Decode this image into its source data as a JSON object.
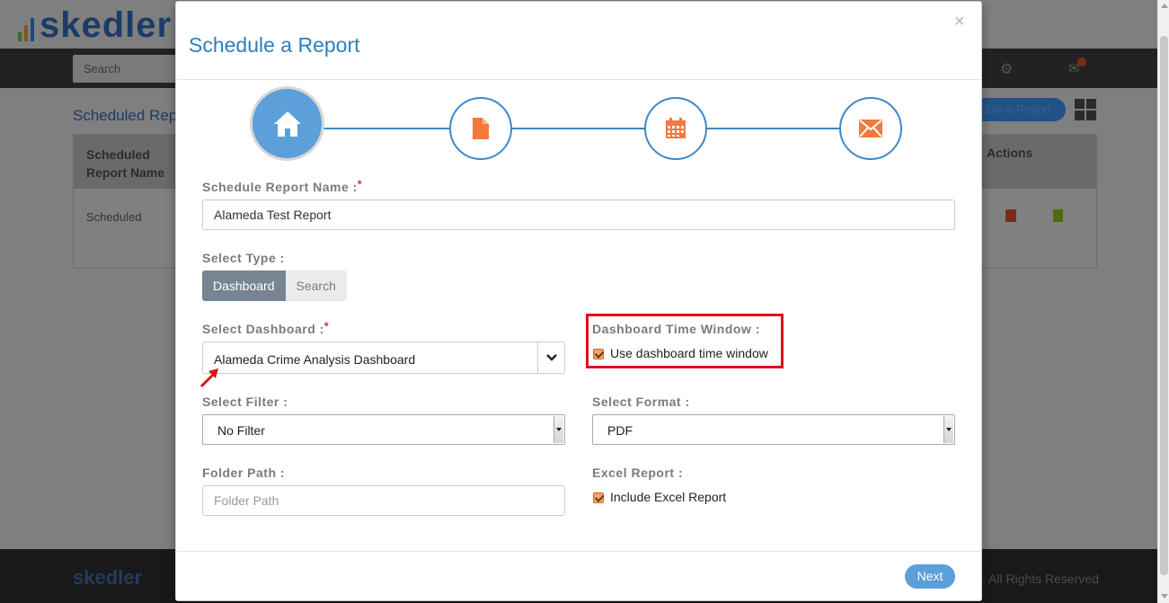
{
  "background": {
    "logo_text": "skedler",
    "search_placeholder": "Search",
    "page_heading": "Scheduled Repo",
    "new_button_label": "dule a Report",
    "table": {
      "col_name_header": "Scheduled Report Name",
      "col_actions_header": "Actions",
      "row_name": "Scheduled"
    },
    "footer_logo": "skedler",
    "footer_text": ". All Rights Reserved"
  },
  "modal": {
    "title": "Schedule a Report",
    "close_glyph": "×",
    "steps": [
      {
        "icon": "home-icon",
        "active": true
      },
      {
        "icon": "document-icon",
        "active": false
      },
      {
        "icon": "calendar-icon",
        "active": false
      },
      {
        "icon": "envelope-icon",
        "active": false
      }
    ],
    "report_name": {
      "label": "Schedule Report Name :",
      "required_mark": "*",
      "value": "Alameda Test Report"
    },
    "select_type": {
      "label": "Select Type :",
      "options": [
        "Dashboard",
        "Search"
      ],
      "selected": "Dashboard"
    },
    "select_dashboard": {
      "label": "Select Dashboard :",
      "required_mark": "*",
      "value": "Alameda Crime Analysis Dashboard"
    },
    "time_window": {
      "label": "Dashboard Time Window :",
      "checkbox_label": "Use dashboard time window",
      "checked": true
    },
    "select_filter": {
      "label": "Select Filter :",
      "value": "No Filter"
    },
    "select_format": {
      "label": "Select Format :",
      "value": "PDF"
    },
    "folder_path": {
      "label": "Folder Path :",
      "placeholder": "Folder Path",
      "value": ""
    },
    "excel_report": {
      "label": "Excel Report :",
      "checkbox_label": "Include Excel Report",
      "checked": true
    },
    "next_label": "Next"
  },
  "colors": {
    "accent": "#3e89c8",
    "active_step": "#5d9fd8",
    "title": "#2d7fbf",
    "annotation": "#e0101a",
    "checkbox": "#f0a36a"
  }
}
